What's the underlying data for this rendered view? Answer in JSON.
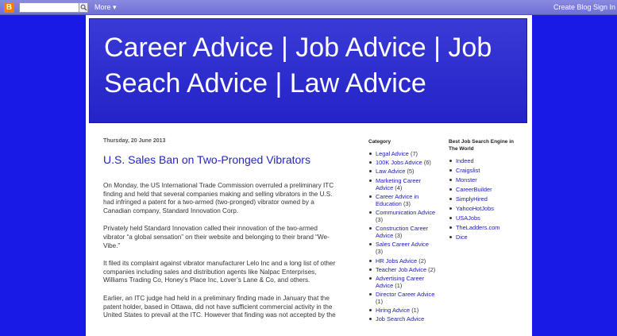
{
  "navbar": {
    "logo": "B",
    "search_placeholder": "",
    "more_label": "More ▾",
    "create_blog": "Create Blog",
    "sign_in": "Sign In"
  },
  "header": {
    "title": "Career Advice | Job Advice | Job Seach Advice | Law Advice"
  },
  "post": {
    "date": "Thursday, 20 June 2013",
    "title": "U.S. Sales Ban on Two-Pronged Vibrators",
    "paragraphs": [
      "On Monday, the US International Trade Commission overruled a preliminary ITC finding and held that several companies making and selling vibrators in the U.S. had infringed a patent for a two-armed (two-pronged) vibrator owned by a Canadian company, Standard Innovation Corp.",
      "Privately held Standard Innovation called their innovation of the two-armed vibrator “a global sensation” on their website and belonging to their brand “We-Vibe.”",
      "It filed its complaint against vibrator manufacturer Lelo Inc and a long list of other companies including sales and distribution agents like Nalpac Enterprises, Williams Trading Co, Honey’s Place Inc, Lover’s Lane & Co, and others.",
      "Earlier, an ITC judge had held in a preliminary finding made in January that the patent holder, based in Ottawa, did not have sufficient commercial activity in the United States to prevail at the ITC. However that finding was not accepted by the"
    ]
  },
  "category": {
    "title": "Category",
    "items": [
      {
        "label": "Legal Advice",
        "count": "(7)"
      },
      {
        "label": "100K Jobs Advice",
        "count": "(6)"
      },
      {
        "label": "Law Advice",
        "count": "(5)"
      },
      {
        "label": "Marketing Career Advice",
        "count": "(4)"
      },
      {
        "label": "Career Advice in Education",
        "count": "(3)"
      },
      {
        "label": "Communication Advice",
        "count": "(3)"
      },
      {
        "label": "Construction Career Advice",
        "count": "(3)"
      },
      {
        "label": "Sales Career Advice",
        "count": "(3)"
      },
      {
        "label": "HR Jobs Advice",
        "count": "(2)"
      },
      {
        "label": "Teacher Job Advice",
        "count": "(2)"
      },
      {
        "label": "Advertising Career Advice",
        "count": "(1)"
      },
      {
        "label": "Director Career Advice",
        "count": "(1)"
      },
      {
        "label": "Hiring Advice",
        "count": "(1)"
      },
      {
        "label": "Job Search Advice",
        "count": ""
      }
    ]
  },
  "engines": {
    "title": "Best Job Search Engine in The World",
    "items": [
      "Indeed",
      "Craigslist",
      "Monster",
      "CareerBuilder",
      "SimplyHired",
      "YahooHotJobs",
      "USAJobs",
      "TheLadders.com",
      "Dice"
    ]
  }
}
